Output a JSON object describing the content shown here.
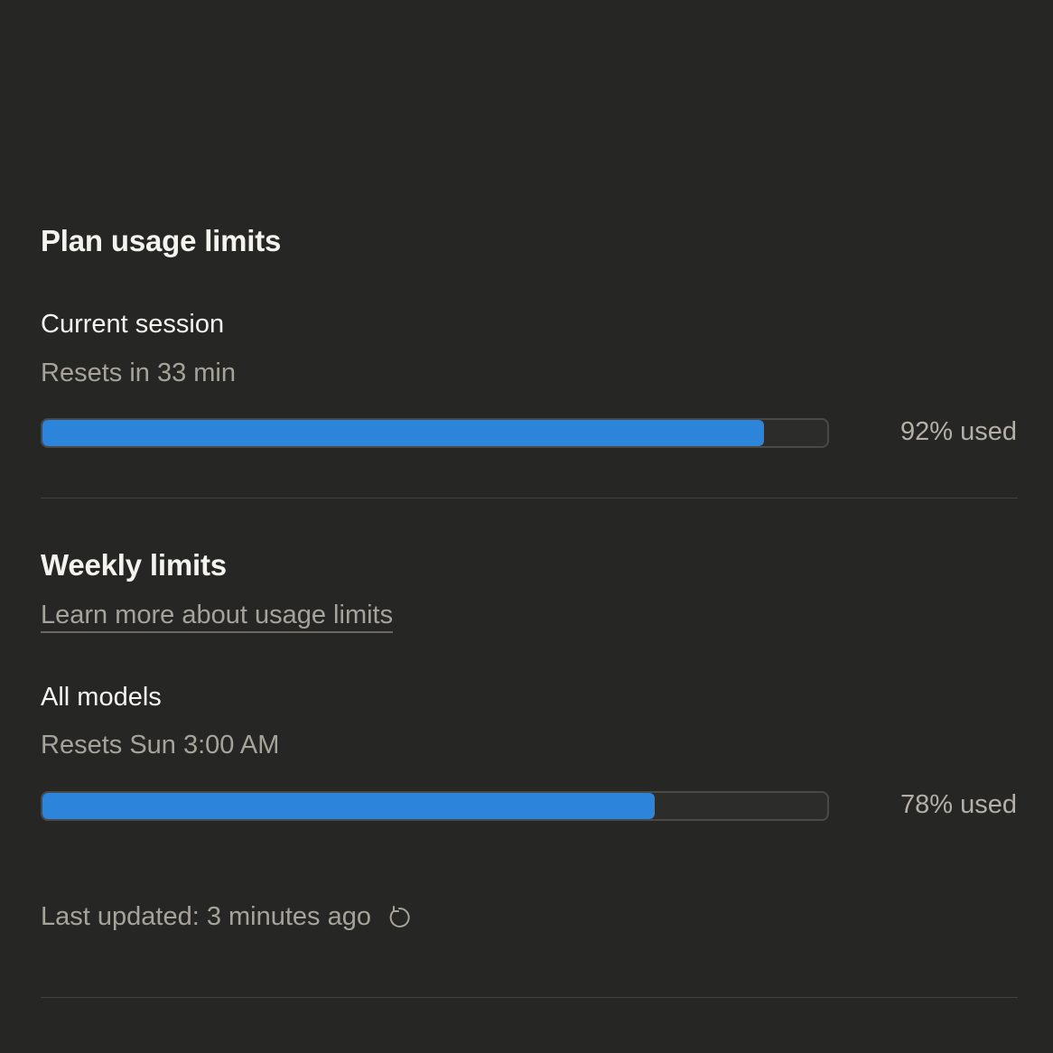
{
  "plan": {
    "title": "Plan usage limits",
    "session": {
      "label": "Current session",
      "reset_text": "Resets in 33 min",
      "used_fraction": 0.92,
      "used_label": "92% used"
    }
  },
  "weekly": {
    "title": "Weekly limits",
    "learn_more_link": "Learn more about usage limits",
    "all_models": {
      "label": "All models",
      "reset_text": "Resets Sun 3:00 AM",
      "used_fraction": 0.78,
      "used_label": "78% used"
    }
  },
  "footer": {
    "last_updated": "Last updated: 3 minutes ago",
    "refresh_icon": "refresh-icon"
  },
  "colors": {
    "background": "#262624",
    "bar_fill": "#2c84db",
    "bar_track": "#2c2c2a"
  }
}
